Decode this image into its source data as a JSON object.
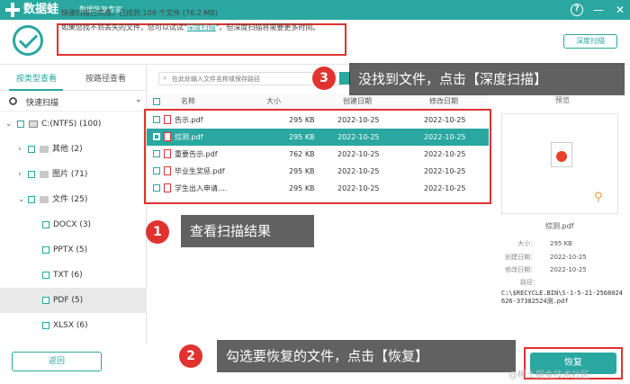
{
  "app": {
    "name": "数据蛙",
    "subtitle": "数据恢复专家"
  },
  "window_controls": {
    "help": "?",
    "minimize": "—",
    "close": "✕"
  },
  "info": {
    "line1": "快速扫描已完成，已找到 109 个文件 (76.2 MB)",
    "line2_prefix": "如果您找不到丢失的文件，您可以试试\"",
    "line2_link": "深度扫描",
    "line2_suffix": "\"。但深度扫描将需要更多时间。",
    "deep_scan_button": "深度扫描"
  },
  "left": {
    "tab_type": "按类型查看",
    "tab_path": "按路径查看",
    "scan_mode": "快速扫描",
    "tree": [
      {
        "label": "C:(NTFS) (100)"
      },
      {
        "label": "其他 (2)"
      },
      {
        "label": "图片 (71)"
      },
      {
        "label": "文件 (25)"
      },
      {
        "label": "DOCX (3)"
      },
      {
        "label": "PPTX (5)"
      },
      {
        "label": "TXT (6)"
      },
      {
        "label": "PDF (5)"
      },
      {
        "label": "XLSX (6)"
      }
    ],
    "back_button": "返回"
  },
  "search": {
    "placeholder": "在此处输入文件名称或保存路径"
  },
  "list": {
    "headers": {
      "name": "名称",
      "size": "大小",
      "created": "创建日期",
      "modified": "修改日期"
    },
    "rows": [
      {
        "name": "告示.pdf",
        "size": "295 KB",
        "created": "2022-10-25",
        "modified": "2022-10-25"
      },
      {
        "name": "综测.pdf",
        "size": "295 KB",
        "created": "2022-10-25",
        "modified": "2022-10-25"
      },
      {
        "name": "重要告示.pdf",
        "size": "762 KB",
        "created": "2022-10-25",
        "modified": "2022-10-25"
      },
      {
        "name": "毕业生奖惩.pdf",
        "size": "295 KB",
        "created": "2022-10-25",
        "modified": "2022-10-25"
      },
      {
        "name": "学生出入申请....",
        "size": "295 KB",
        "created": "2022-10-25",
        "modified": "2022-10-25"
      }
    ]
  },
  "preview": {
    "title": "预览",
    "file_name": "综测.pdf",
    "size_label": "大小：",
    "size_value": "295 KB",
    "created_label": "创建日期：",
    "created_value": "2022-10-25",
    "modified_label": "修改日期：",
    "modified_value": "2022-10-25",
    "path_label": "路径：",
    "path_value": "C:\\$RECYCLE.BIN\\S-1-5-21-2568024626-3738252​4测.pdf"
  },
  "recover_button": "恢复",
  "callouts": [
    {
      "num": "1",
      "text": "查看扫描结果"
    },
    {
      "num": "2",
      "text": "勾选要恢复的文件，点击【恢复】"
    },
    {
      "num": "3",
      "text": "没找到文件，点击【深度扫描】"
    }
  ],
  "watermark": "@稀土掘金技术社区",
  "colors": {
    "accent": "#29a7a0",
    "highlight_red": "#e0332f"
  }
}
